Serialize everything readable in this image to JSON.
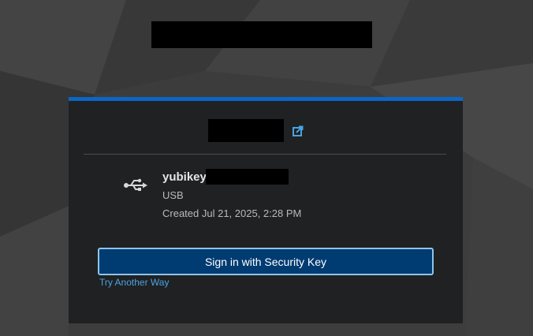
{
  "authenticator": {
    "name_prefix": "yubikey",
    "transport": "USB",
    "created": "Created Jul 21, 2025, 2:28 PM",
    "icon": "usb-icon"
  },
  "actions": {
    "signin_label": "Sign in with Security Key",
    "try_another_label": "Try Another Way"
  },
  "icons": {
    "external_link": "external-link-icon"
  },
  "colors": {
    "accent_bar": "#0b66c3",
    "button_bg": "#003b72",
    "button_border": "#8fc5e8",
    "link": "#4aa3e0",
    "card_bg": "#1f2123"
  }
}
